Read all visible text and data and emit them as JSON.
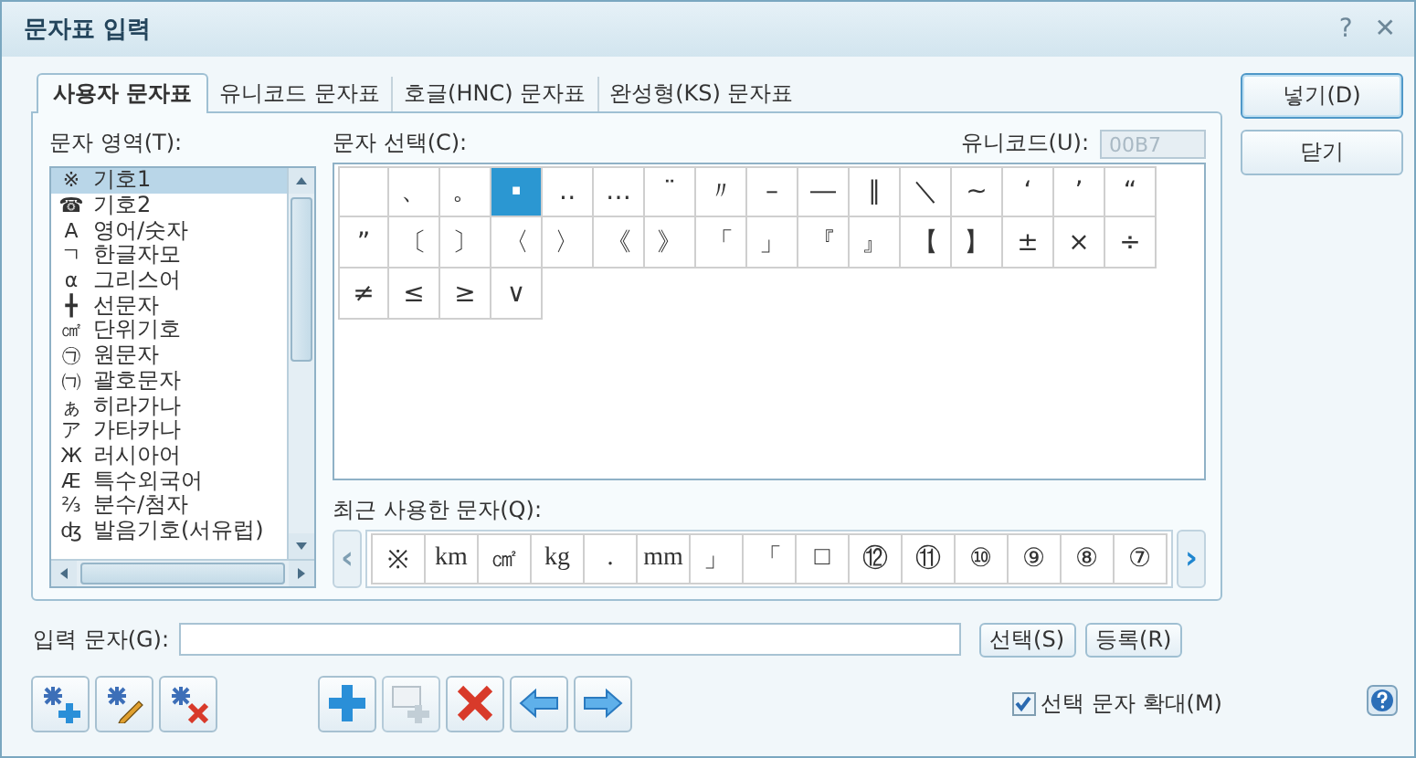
{
  "window": {
    "title": "문자표 입력",
    "help": "?",
    "close": "✕"
  },
  "tabs": [
    {
      "label": "사용자 문자표",
      "selected": true
    },
    {
      "label": "유니코드 문자표",
      "selected": false
    },
    {
      "label": "호글(HNC) 문자표",
      "selected": false
    },
    {
      "label": "완성형(KS) 문자표",
      "selected": false
    }
  ],
  "area": {
    "label": "문자 영역(T):",
    "items": [
      {
        "icon": "※",
        "label": "기호1",
        "selected": true
      },
      {
        "icon": "☎",
        "label": "기호2",
        "selected": false
      },
      {
        "icon": "A",
        "label": "영어/숫자",
        "selected": false
      },
      {
        "icon": "ㄱ",
        "label": "한글자모",
        "selected": false
      },
      {
        "icon": "α",
        "label": "그리스어",
        "selected": false
      },
      {
        "icon": "╋",
        "label": "선문자",
        "selected": false
      },
      {
        "icon": "㎠",
        "label": "단위기호",
        "selected": false
      },
      {
        "icon": "㉠",
        "label": "원문자",
        "selected": false
      },
      {
        "icon": "㈀",
        "label": "괄호문자",
        "selected": false
      },
      {
        "icon": "ぁ",
        "label": "히라가나",
        "selected": false
      },
      {
        "icon": "ア",
        "label": "가타카나",
        "selected": false
      },
      {
        "icon": "Ж",
        "label": "러시아어",
        "selected": false
      },
      {
        "icon": "Æ",
        "label": "특수외국어",
        "selected": false
      },
      {
        "icon": "⅔",
        "label": "분수/첨자",
        "selected": false
      },
      {
        "icon": "ʤ",
        "label": "발음기호(서유럽)",
        "selected": false
      }
    ]
  },
  "chars": {
    "label": "문자 선택(C):",
    "unicode_label": "유니코드(U):",
    "unicode_value": "00B7",
    "rows": [
      [
        {
          "selected": false
        },
        {
          "ch": "、",
          "selected": false
        },
        {
          "ch": "。",
          "selected": false
        },
        {
          "ch": "·",
          "selected": true
        },
        {
          "ch": "‥",
          "selected": false
        },
        {
          "ch": "…",
          "selected": false
        },
        {
          "ch": "¨",
          "selected": false
        },
        {
          "ch": "〃",
          "selected": false
        },
        {
          "ch": "–",
          "selected": false
        },
        {
          "ch": "―",
          "selected": false
        },
        {
          "ch": "∥",
          "selected": false
        },
        {
          "ch": "＼",
          "selected": false
        },
        {
          "ch": "∼",
          "selected": false
        },
        {
          "ch": "‘",
          "selected": false
        },
        {
          "ch": "’",
          "selected": false
        },
        {
          "ch": "“",
          "selected": false
        }
      ],
      [
        {
          "ch": "”",
          "selected": false
        },
        {
          "ch": "〔",
          "selected": false
        },
        {
          "ch": "〕",
          "selected": false
        },
        {
          "ch": "〈",
          "selected": false
        },
        {
          "ch": "〉",
          "selected": false
        },
        {
          "ch": "《",
          "selected": false
        },
        {
          "ch": "》",
          "selected": false
        },
        {
          "ch": "「",
          "selected": false
        },
        {
          "ch": "」",
          "selected": false
        },
        {
          "ch": "『",
          "selected": false
        },
        {
          "ch": "』",
          "selected": false
        },
        {
          "ch": "【",
          "selected": false
        },
        {
          "ch": "】",
          "selected": false
        },
        {
          "ch": "±",
          "selected": false
        },
        {
          "ch": "×",
          "selected": false
        },
        {
          "ch": "÷",
          "selected": false
        }
      ],
      [
        {
          "ch": "≠",
          "selected": false
        },
        {
          "ch": "≤",
          "selected": false
        },
        {
          "ch": "≥",
          "selected": false
        },
        {
          "ch": "∨",
          "selected": false
        }
      ]
    ]
  },
  "recent": {
    "label": "최근 사용한 문자(Q):",
    "prev": "‹",
    "next": "›",
    "items": [
      "※",
      "km",
      "㎠",
      "kg",
      ".",
      "mm",
      "」",
      "「",
      "□",
      "⑫",
      "⑪",
      "⑩",
      "⑨",
      "⑧",
      "⑦"
    ]
  },
  "input": {
    "label": "입력 문자(G):"
  },
  "input_buttons": [
    "선택(S)",
    "등록(R)"
  ],
  "side_buttons": [
    {
      "label": "넣기(D)",
      "default": true
    },
    {
      "label": "닫기",
      "default": false
    }
  ],
  "toolbar": [
    {
      "kind": "star-add",
      "disabled": false
    },
    {
      "kind": "star-edit",
      "disabled": false
    },
    {
      "kind": "star-delete",
      "disabled": false
    },
    {
      "kind": "gap"
    },
    {
      "kind": "plus",
      "disabled": false
    },
    {
      "kind": "window-add",
      "disabled": true
    },
    {
      "kind": "delete",
      "disabled": false
    },
    {
      "kind": "left",
      "disabled": false
    },
    {
      "kind": "right",
      "disabled": false
    }
  ],
  "enlarge": {
    "label": "선택 문자 확대(M)",
    "checked": true
  }
}
